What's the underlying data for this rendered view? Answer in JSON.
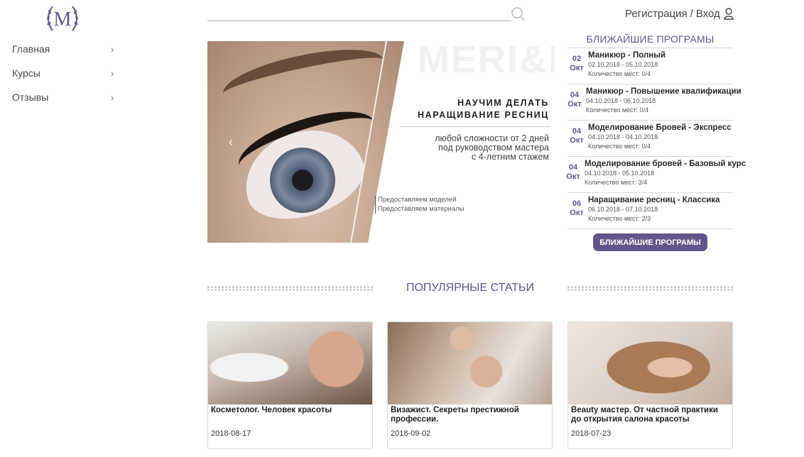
{
  "logo": {
    "letter": "M",
    "color": "#62558b"
  },
  "nav": {
    "items": [
      {
        "label": "Главная"
      },
      {
        "label": "Курсы"
      },
      {
        "label": "Отзывы"
      }
    ]
  },
  "search": {
    "placeholder": "",
    "value": ""
  },
  "auth": {
    "register": "Регистрация",
    "separator": "/",
    "login": "Вход"
  },
  "hero": {
    "watermark": "MERI&MEDI",
    "title_line1": "НАУЧИМ ДЕЛАТЬ",
    "title_line2": "НАРАЩИВАНИЕ РЕСНИЦ",
    "sub_line1": "любой сложности от 2 дней",
    "sub_line2": "под руководством мастера",
    "sub_line3": "с 4-летним стажем",
    "note1": "Предоставляем моделей",
    "note2": "Предоставляем материалы"
  },
  "programs": {
    "title": "БЛИЖАЙШИЕ ПРОГРАМЫ",
    "button": "БЛИЖАЙШИЕ ПРОГРАМЫ",
    "items": [
      {
        "day": "02",
        "month": "Окт",
        "name": "Маникюр - Полный",
        "range": "02.10.2018 - 05.10.2018",
        "seats": "Количество мест: 0/4"
      },
      {
        "day": "04",
        "month": "Окт",
        "name": "Маникюр - Повышение квалификации",
        "range": "04.10.2018 - 06.10.2018",
        "seats": "Количество мест: 0/4"
      },
      {
        "day": "04",
        "month": "Окт",
        "name": "Моделирование Бровей - Экспресс",
        "range": "04.10.2018 - 04.10.2018",
        "seats": "Количество мест: 0/4"
      },
      {
        "day": "04",
        "month": "Окт",
        "name": "Моделирование бровей - Базовый курс",
        "range": "04.10.2018 - 05.10.2018",
        "seats": "Количество мест: 3/4"
      },
      {
        "day": "06",
        "month": "Окт",
        "name": "Наращивание ресниц - Классика",
        "range": "06.10.2018 - 07.10.2018",
        "seats": "Количество мест: 2/3"
      }
    ]
  },
  "popular": {
    "title": "ПОПУЛЯРНЫЕ СТАТЬИ",
    "articles": [
      {
        "title": "Косметолог. Человек красоты",
        "date": "2018-08-17"
      },
      {
        "title": "Визажист. Секреты престижной профессии.",
        "date": "2018-09-02"
      },
      {
        "title": "Beauty мастер. От частной практики до открытия салона красоты",
        "date": "2018-07-23"
      }
    ]
  }
}
